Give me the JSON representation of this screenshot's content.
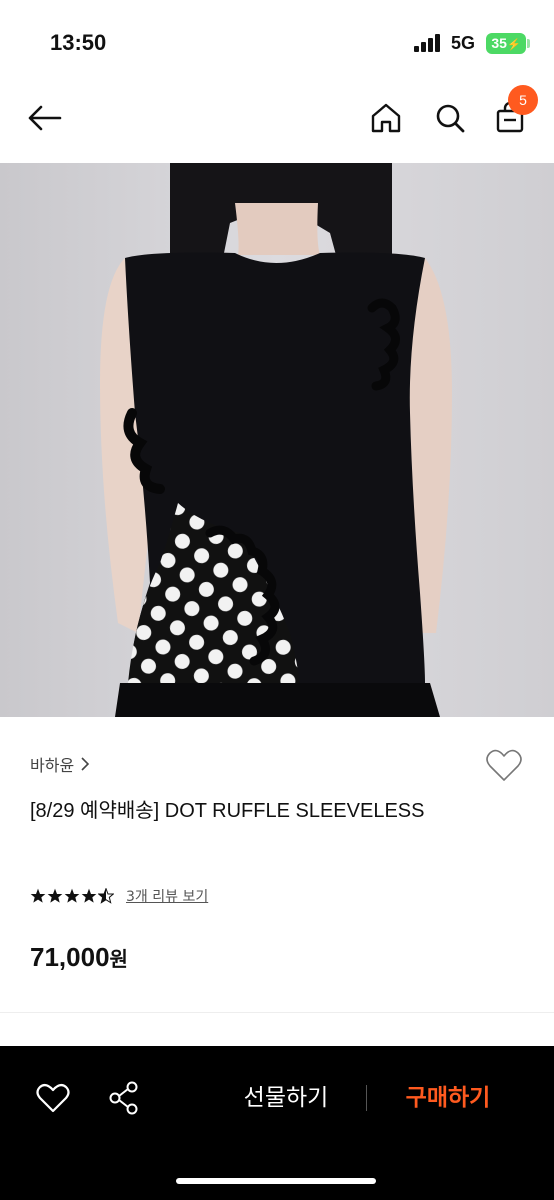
{
  "status": {
    "time": "13:50",
    "network": "5G",
    "battery": "35"
  },
  "nav": {
    "cart_count": "5"
  },
  "product": {
    "brand": "바하윤",
    "title": "[8/29 예약배송] DOT RUFFLE SLEEVELESS",
    "rating": 4.5,
    "review_link": "3개 리뷰 보기",
    "price": "71,000",
    "price_unit": "원",
    "image_alt": "model wearing black sleeveless top with polka dot ruffle panel"
  },
  "bottom_bar": {
    "gift_label": "선물하기",
    "buy_label": "구매하기"
  },
  "colors": {
    "accent": "#ff5a1f",
    "bar": "#000000",
    "battery": "#4cd964"
  }
}
